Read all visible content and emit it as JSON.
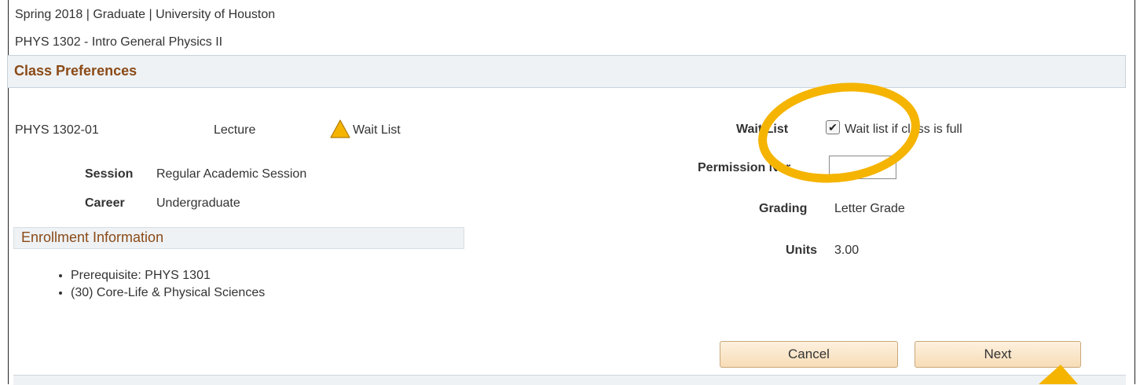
{
  "header": {
    "term_line": "Spring 2018 | Graduate | University of Houston",
    "course_title": "PHYS 1302 - Intro General Physics II"
  },
  "class_preferences": {
    "title": "Class Preferences",
    "section_id": "PHYS 1302-01",
    "component": "Lecture",
    "status": {
      "icon": "warning-triangle-icon",
      "label": "Wait List"
    },
    "session": {
      "label": "Session",
      "value": "Regular Academic Session"
    },
    "career": {
      "label": "Career",
      "value": "Undergraduate"
    }
  },
  "enrollment_info": {
    "title": "Enrollment Information",
    "items": [
      "Prerequisite: PHYS 1301",
      "(30) Core-Life & Physical Sciences"
    ]
  },
  "preferences": {
    "wait_list": {
      "label": "Wait List",
      "checkbox_text": "Wait list if class is full",
      "checked": true
    },
    "permission_nbr": {
      "label": "Permission Nbr",
      "value": ""
    },
    "grading": {
      "label": "Grading",
      "value": "Letter Grade"
    },
    "units": {
      "label": "Units",
      "value": "3.00"
    }
  },
  "buttons": {
    "cancel": "Cancel",
    "next": "Next"
  },
  "colors": {
    "section_title": "#8b4a17",
    "highlight": "#f5b400",
    "button_bg": "#f7dcb6"
  }
}
